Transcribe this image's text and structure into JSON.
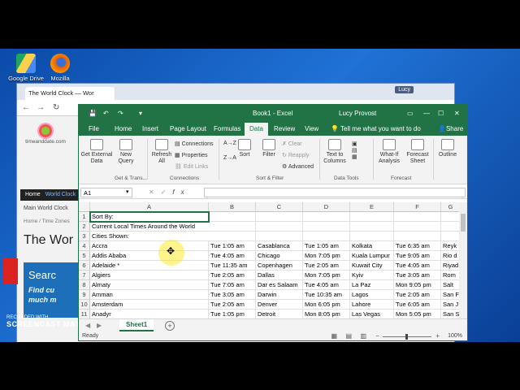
{
  "desktop": {
    "icons": [
      {
        "label": "Google Drive",
        "icon": "google-drive-icon"
      },
      {
        "label": "Mozilla",
        "icon": "firefox-icon"
      }
    ]
  },
  "browser": {
    "tab_title": "The World Clock — Wor",
    "user_tag": "Lucy",
    "site": {
      "logo_text": "timeanddate.com",
      "nav_home": "Home",
      "nav_world_clock": "World Clock",
      "menu_main": "Main World Clock",
      "crumb": "Home / Time Zones",
      "title": "The Wor",
      "search_big": "Searc",
      "search_line1": "Find cu",
      "search_line2": "much m"
    }
  },
  "watermark": {
    "small": "RECORDED WITH",
    "brand": "SCREENCAST MATIC"
  },
  "excel": {
    "quick_access": [
      "save-icon",
      "undo-icon",
      "redo-icon"
    ],
    "title": "Book1 - Excel",
    "user": "Lucy Provost",
    "window_controls": [
      "ribbon-options-icon",
      "minimize-icon",
      "restore-icon",
      "close-icon"
    ],
    "ribbon_tabs": [
      "File",
      "Home",
      "Insert",
      "Page Layout",
      "Formulas",
      "Data",
      "Review",
      "View"
    ],
    "active_tab": "Data",
    "tell_me": "Tell me what you want to do",
    "share": "Share",
    "ribbon": {
      "get_external": "Get External Data",
      "new_query": "New Query",
      "refresh_all": "Refresh All",
      "connections": "Connections",
      "properties": "Properties",
      "edit_links": "Edit Links",
      "sort_az": "A→Z",
      "sort_za": "Z→A",
      "sort": "Sort",
      "filter": "Filter",
      "clear": "Clear",
      "reapply": "Reapply",
      "advanced": "Advanced",
      "text_to_columns": "Text to Columns",
      "what_if": "What-If Analysis",
      "forecast_sheet": "Forecast Sheet",
      "outline": "Outline",
      "group_get_transform": "Get & Trans...",
      "group_connections": "Connections",
      "group_sort_filter": "Sort & Filter",
      "group_data_tools": "Data Tools",
      "group_forecast": "Forecast"
    },
    "name_box": "A1",
    "formula": "",
    "columns": [
      "A",
      "B",
      "C",
      "D",
      "E",
      "F",
      "G"
    ],
    "rows": [
      {
        "num": "1",
        "cells": [
          "Sort By:",
          "",
          "",
          "",
          "",
          "",
          ""
        ]
      },
      {
        "num": "2",
        "cells": [
          "Current Local Times Around the World",
          "",
          "",
          "",
          "",
          "",
          ""
        ]
      },
      {
        "num": "3",
        "cells": [
          "Cities Shown:",
          "",
          "",
          "",
          "",
          "",
          ""
        ]
      },
      {
        "num": "4",
        "cells": [
          "Accra",
          "Tue 1:05 am",
          "Casablanca",
          "Tue 1:05 am",
          "Kolkata",
          "Tue 6:35 am",
          "Reyk"
        ]
      },
      {
        "num": "5",
        "cells": [
          "Addis Ababa",
          "Tue 4:05 am",
          "Chicago",
          "Mon 7:05 pm",
          "Kuala Lumpur",
          "Tue 9:05 am",
          "Rio d"
        ]
      },
      {
        "num": "6",
        "cells": [
          "Adelaide *",
          "Tue 11:35 am",
          "Copenhagen",
          "Tue 2:05 am",
          "Kuwait City",
          "Tue 4:05 am",
          "Riyad"
        ]
      },
      {
        "num": "7",
        "cells": [
          "Algiers",
          "Tue 2:05 am",
          "Dallas",
          "Mon 7:05 pm",
          "Kyiv",
          "Tue 3:05 am",
          "Rom"
        ]
      },
      {
        "num": "8",
        "cells": [
          "Almaty",
          "Tue 7:05 am",
          "Dar es Salaam",
          "Tue 4:05 am",
          "La Paz",
          "Mon 9:05 pm",
          "Salt"
        ]
      },
      {
        "num": "9",
        "cells": [
          "Amman",
          "Tue 3:05 am",
          "Darwin",
          "Tue 10:35 am",
          "Lagos",
          "Tue 2:05 am",
          "San F"
        ]
      },
      {
        "num": "10",
        "cells": [
          "Amsterdam",
          "Tue 2:05 am",
          "Denver",
          "Mon 6:05 pm",
          "Lahore",
          "Tue 6:05 am",
          "San J"
        ]
      },
      {
        "num": "11",
        "cells": [
          "Anadyr",
          "Tue 1:05 pm",
          "Detroit",
          "Mon 8:05 pm",
          "Las Vegas",
          "Mon 5:05 pm",
          "San S"
        ]
      }
    ],
    "sheet_tab": "Sheet1",
    "status": "Ready",
    "zoom": "100%"
  }
}
